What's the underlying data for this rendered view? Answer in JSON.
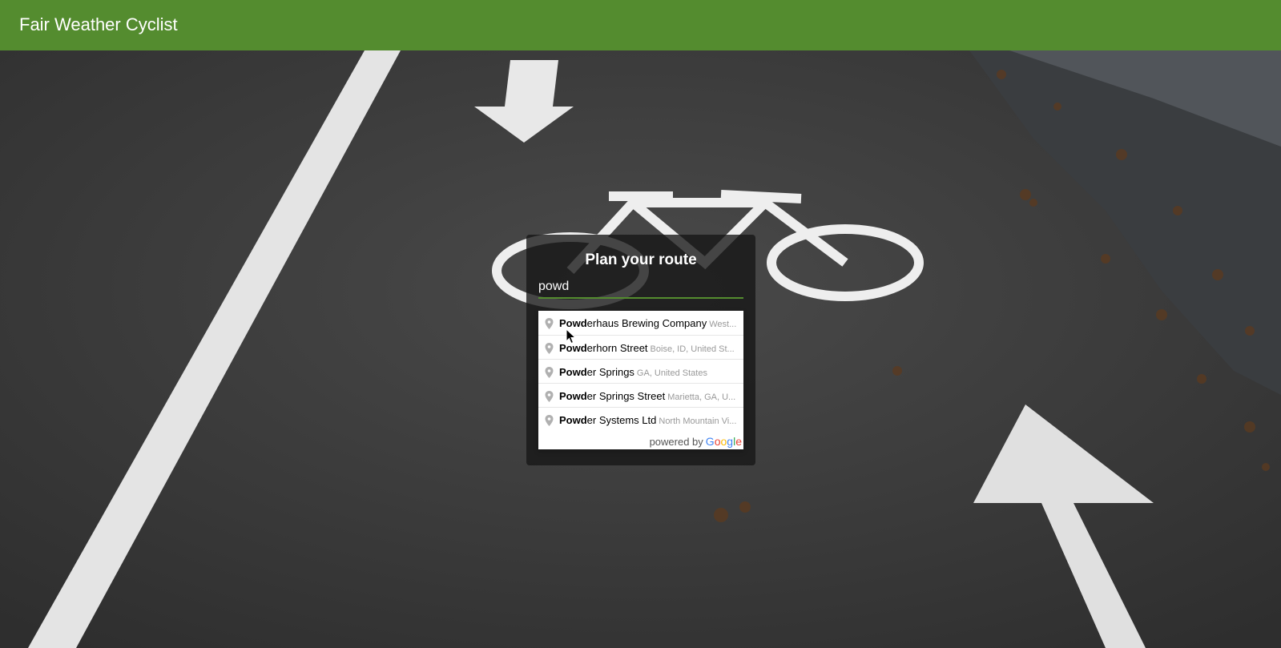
{
  "header": {
    "title": "Fair Weather Cyclist",
    "background_color": "#548c2f"
  },
  "background": {
    "icon": "bike-lane-photo"
  },
  "route_panel": {
    "title": "Plan your route",
    "search": {
      "value": "powd"
    }
  },
  "autocomplete": {
    "items": [
      {
        "match": "Powd",
        "rest": "erhaus Brewing Company",
        "secondary": "West..."
      },
      {
        "match": "Powd",
        "rest": "erhorn Street",
        "secondary": "Boise, ID, United St..."
      },
      {
        "match": "Powd",
        "rest": "er Springs",
        "secondary": "GA, United States"
      },
      {
        "match": "Powd",
        "rest": "er Springs Street",
        "secondary": "Marietta, GA, U..."
      },
      {
        "match": "Powd",
        "rest": "er Systems Ltd",
        "secondary": "North Mountain Vi..."
      }
    ],
    "powered_by": "powered by",
    "google": "Google"
  }
}
